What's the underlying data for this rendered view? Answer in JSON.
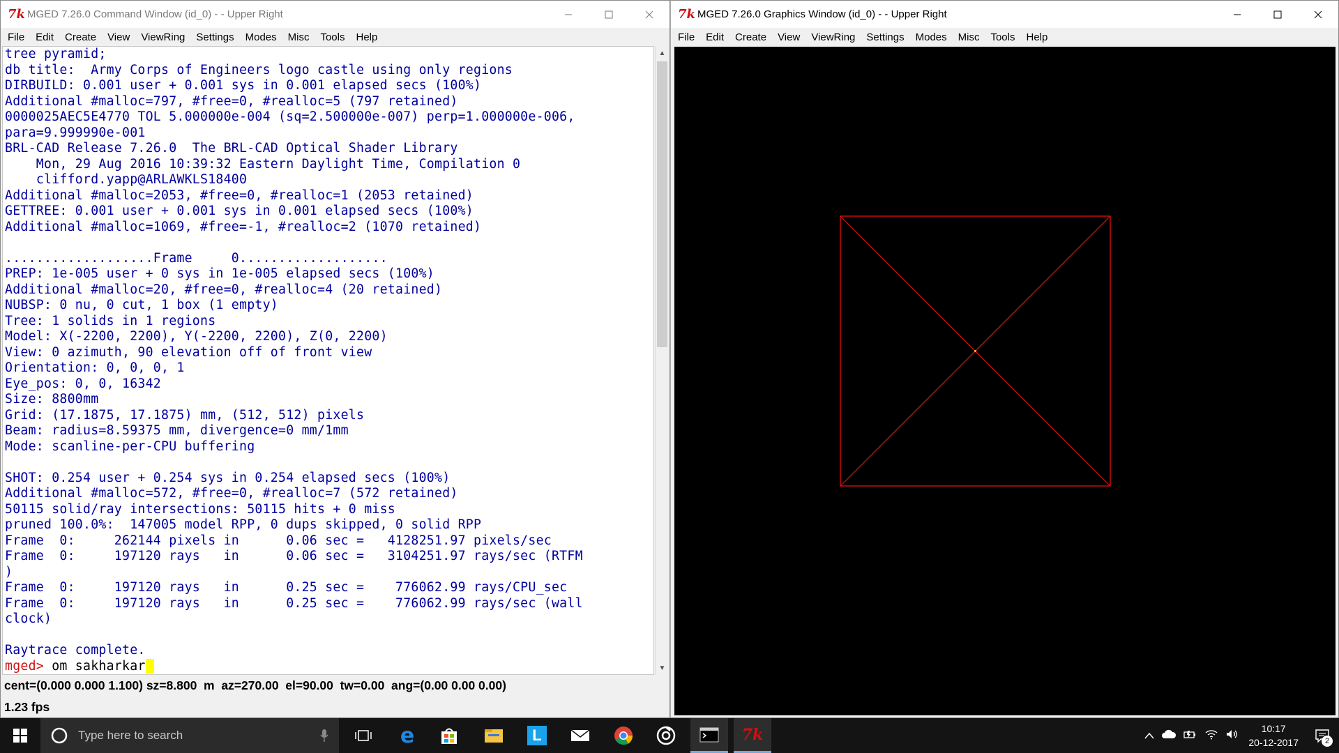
{
  "command_window": {
    "title": "MGED 7.26.0 Command Window (id_0) -  - Upper Right",
    "menu": [
      "File",
      "Edit",
      "Create",
      "View",
      "ViewRing",
      "Settings",
      "Modes",
      "Misc",
      "Tools",
      "Help"
    ],
    "console_lines": [
      "tree pyramid;",
      "db title:  Army Corps of Engineers logo castle using only regions",
      "DIRBUILD: 0.001 user + 0.001 sys in 0.001 elapsed secs (100%)",
      "Additional #malloc=797, #free=0, #realloc=5 (797 retained)",
      "0000025AEC5E4770 TOL 5.000000e-004 (sq=2.500000e-007) perp=1.000000e-006,",
      "para=9.999990e-001",
      "BRL-CAD Release 7.26.0  The BRL-CAD Optical Shader Library",
      "    Mon, 29 Aug 2016 10:39:32 Eastern Daylight Time, Compilation 0",
      "    clifford.yapp@ARLAWKLS18400",
      "Additional #malloc=2053, #free=0, #realloc=1 (2053 retained)",
      "GETTREE: 0.001 user + 0.001 sys in 0.001 elapsed secs (100%)",
      "Additional #malloc=1069, #free=-1, #realloc=2 (1070 retained)",
      "",
      "...................Frame     0...................",
      "PREP: 1e-005 user + 0 sys in 1e-005 elapsed secs (100%)",
      "Additional #malloc=20, #free=0, #realloc=4 (20 retained)",
      "NUBSP: 0 nu, 0 cut, 1 box (1 empty)",
      "Tree: 1 solids in 1 regions",
      "Model: X(-2200, 2200), Y(-2200, 2200), Z(0, 2200)",
      "View: 0 azimuth, 90 elevation off of front view",
      "Orientation: 0, 0, 0, 1",
      "Eye_pos: 0, 0, 16342",
      "Size: 8800mm",
      "Grid: (17.1875, 17.1875) mm, (512, 512) pixels",
      "Beam: radius=8.59375 mm, divergence=0 mm/1mm",
      "Mode: scanline-per-CPU buffering",
      "",
      "SHOT: 0.254 user + 0.254 sys in 0.254 elapsed secs (100%)",
      "Additional #malloc=572, #free=0, #realloc=7 (572 retained)",
      "50115 solid/ray intersections: 50115 hits + 0 miss",
      "pruned 100.0%:  147005 model RPP, 0 dups skipped, 0 solid RPP",
      "Frame  0:     262144 pixels in      0.06 sec =   4128251.97 pixels/sec",
      "Frame  0:     197120 rays   in      0.06 sec =   3104251.97 rays/sec (RTFM",
      ")",
      "Frame  0:     197120 rays   in      0.25 sec =    776062.99 rays/CPU_sec",
      "Frame  0:     197120 rays   in      0.25 sec =    776062.99 rays/sec (wall",
      "clock)",
      "",
      "Raytrace complete."
    ],
    "prompt": "mged>",
    "command_text": " om sakharkar",
    "status_line": "cent=(0.000 0.000 1.100) sz=8.800  m  az=270.00  el=90.00  tw=0.00  ang=(0.00 0.00 0.00)",
    "fps": "1.23 fps"
  },
  "graphics_window": {
    "title": "MGED 7.26.0 Graphics Window (id_0) -  - Upper Right",
    "menu": [
      "File",
      "Edit",
      "Create",
      "View",
      "ViewRing",
      "Settings",
      "Modes",
      "Misc",
      "Tools",
      "Help"
    ],
    "wireframe_color": "#e01010",
    "center_dot_color": "#ffcc00"
  },
  "taskbar": {
    "search_placeholder": "Type here to search",
    "time": "10:17",
    "date": "20-12-2017",
    "notification_count": "2",
    "apps": [
      "task-view",
      "edge",
      "store",
      "file-explorer",
      "l-app",
      "mail",
      "chrome",
      "media-app",
      "console",
      "mged"
    ]
  },
  "colors": {
    "console_text": "#0000a0",
    "prompt": "#d01010",
    "cursor": "#ffff00"
  }
}
